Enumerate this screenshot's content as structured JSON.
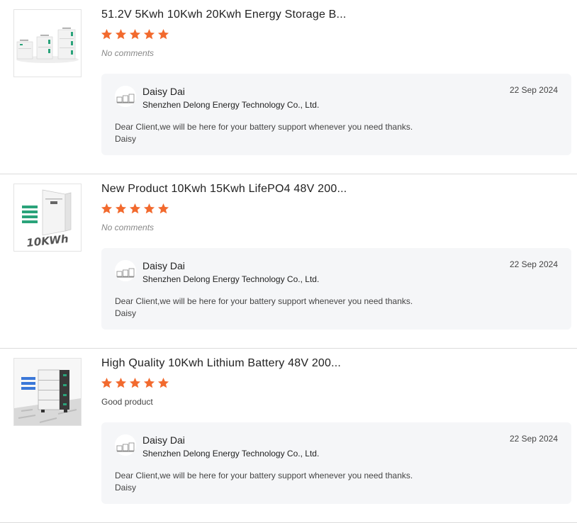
{
  "reviews": [
    {
      "product_title": "51.2V 5Kwh 10Kwh 20Kwh Energy Storage B...",
      "rating": 5,
      "comment": "No comments",
      "reply": {
        "author": "Daisy Dai",
        "company": "Shenzhen Delong Energy Technology Co., Ltd.",
        "date": "22 Sep 2024",
        "message_line1": "Dear Client,we will be here for your battery support whenever you need thanks.",
        "message_line2": "Daisy"
      }
    },
    {
      "product_title": "New Product 10Kwh 15Kwh LifePO4 48V 200...",
      "rating": 5,
      "comment": "No comments",
      "image_text": "10KWh",
      "reply": {
        "author": "Daisy Dai",
        "company": "Shenzhen Delong Energy Technology Co., Ltd.",
        "date": "22 Sep 2024",
        "message_line1": "Dear Client,we will be here for your battery support whenever you need thanks.",
        "message_line2": "Daisy"
      }
    },
    {
      "product_title": "High Quality 10Kwh Lithium Battery 48V 200...",
      "rating": 5,
      "comment": "Good product",
      "reply": {
        "author": "Daisy Dai",
        "company": "Shenzhen Delong Energy Technology Co., Ltd.",
        "date": "22 Sep 2024",
        "message_line1": "Dear Client,we will be here for your battery support whenever you need thanks.",
        "message_line2": "Daisy"
      }
    }
  ],
  "colors": {
    "star": "#f26a2e",
    "reply_bg": "#f5f6f8",
    "divider": "#dcdcdc"
  }
}
